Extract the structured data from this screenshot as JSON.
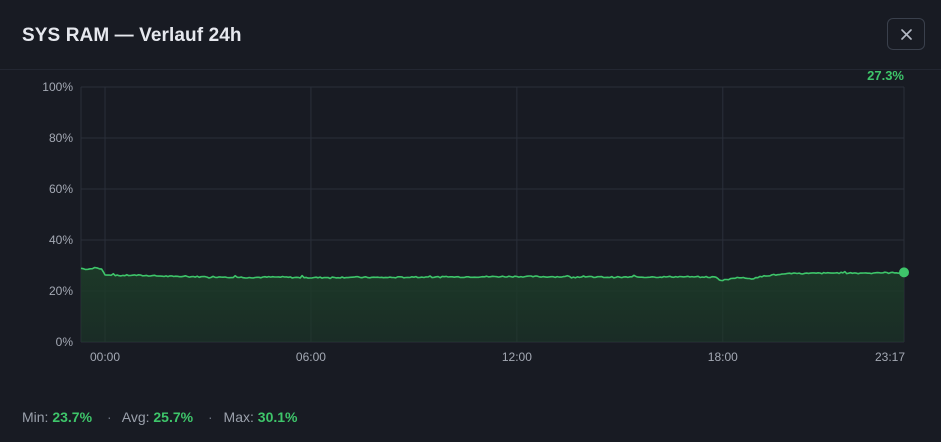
{
  "dialog": {
    "title": "SYS RAM — Verlauf 24h",
    "close_symbol": "✕"
  },
  "stats": {
    "min_label": "Min:",
    "min_value": "23.7%",
    "separator_1": "·",
    "avg_label": "Avg:",
    "avg_value": "25.7%",
    "separator_2": "·",
    "max_label": "Max:",
    "max_value": "30.1%"
  },
  "colors": {
    "background": "#181b23",
    "line": "#3ec56a",
    "fill": "#1c3a28",
    "grid": "#2a2f3a"
  },
  "chart_data": {
    "type": "area",
    "current_label": "27.3%",
    "y_ticks": [
      "100%",
      "80%",
      "60%",
      "40%",
      "20%",
      "0%"
    ],
    "x_ticks": [
      "00:00",
      "06:00",
      "12:00",
      "18:00",
      "23:17"
    ],
    "ylim": [
      0,
      100
    ],
    "xlim_hours": [
      -0.7,
      23.28
    ],
    "grid": true,
    "series": [
      {
        "x": [
          -0.7,
          -0.5,
          -0.3,
          -0.1,
          0.0,
          0.3,
          0.8,
          1.5,
          2.0,
          2.8,
          3.5,
          4.2,
          5.0,
          5.8,
          6.5,
          7.2,
          8.0,
          9.0,
          10.0,
          11.0,
          12.0,
          13.0,
          14.0,
          15.0,
          16.0,
          16.8,
          17.4,
          17.8,
          17.95,
          18.1,
          18.3,
          18.6,
          18.9,
          19.2,
          19.6,
          20.0,
          20.5,
          21.0,
          21.5,
          22.0,
          22.5,
          23.0,
          23.28
        ],
        "y": [
          28.9,
          28.5,
          29.2,
          28.6,
          26.3,
          26.0,
          26.2,
          25.9,
          25.7,
          25.6,
          25.5,
          25.3,
          25.5,
          25.2,
          25.3,
          25.4,
          25.3,
          25.4,
          25.5,
          25.6,
          25.7,
          25.6,
          25.5,
          25.4,
          25.5,
          25.6,
          25.5,
          25.4,
          24.1,
          24.5,
          25.0,
          25.3,
          24.8,
          26.0,
          26.4,
          26.8,
          26.9,
          27.0,
          27.1,
          27.0,
          27.2,
          27.1,
          27.3
        ]
      }
    ]
  }
}
